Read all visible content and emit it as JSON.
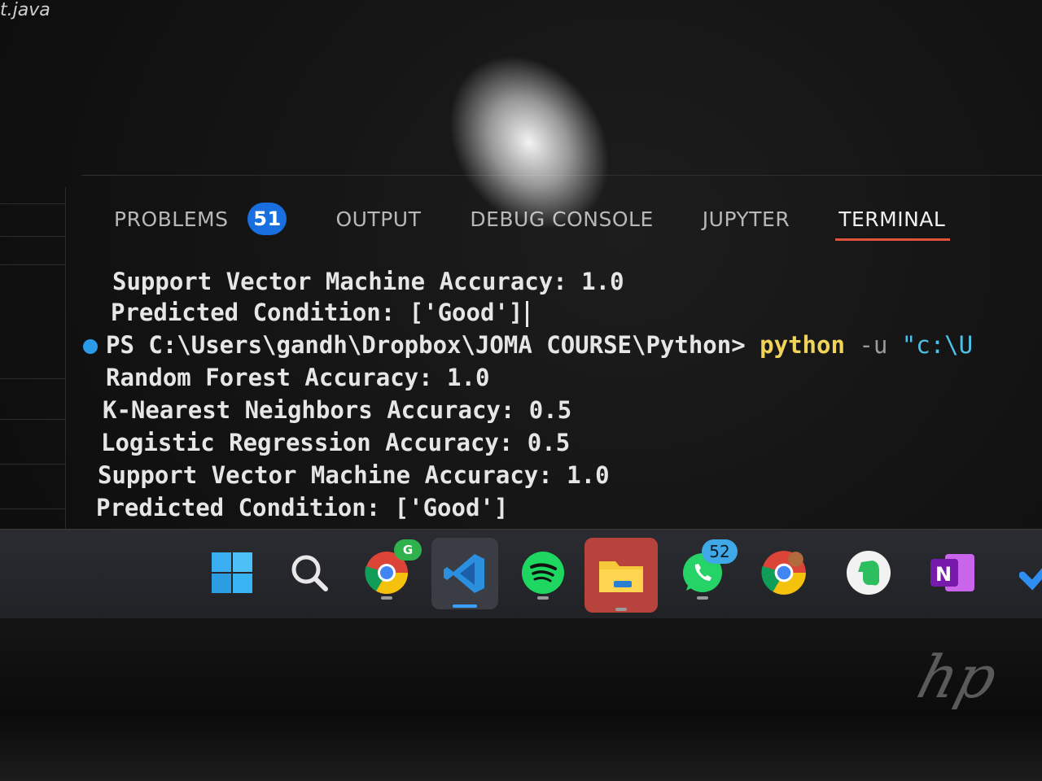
{
  "window": {
    "file_tab_fragment": "t.java"
  },
  "panel": {
    "tabs": [
      {
        "label": "PROBLEMS",
        "badge": "51"
      },
      {
        "label": "OUTPUT"
      },
      {
        "label": "DEBUG CONSOLE"
      },
      {
        "label": "JUPYTER"
      },
      {
        "label": "TERMINAL",
        "active": true
      }
    ],
    "terminal_lines": [
      "Support Vector Machine Accuracy: 1.0",
      "Predicted Condition: ['Good']",
      "Random Forest Accuracy: 1.0",
      "K-Nearest Neighbors Accuracy: 0.5",
      "Logistic Regression Accuracy: 0.5",
      "Support Vector Machine Accuracy: 1.0",
      "Predicted Condition: ['Good']"
    ],
    "prompt": {
      "path": "PS C:\\Users\\gandh\\Dropbox\\JOMA COURSE\\Python>",
      "command": "python",
      "flag": "-u",
      "arg": "\"c:\\U"
    }
  },
  "taskbar": {
    "icons": [
      {
        "name": "windows-start-icon"
      },
      {
        "name": "search-icon"
      },
      {
        "name": "chrome-profile-g-icon",
        "badge": "G"
      },
      {
        "name": "vscode-icon"
      },
      {
        "name": "spotify-icon"
      },
      {
        "name": "file-explorer-icon"
      },
      {
        "name": "whatsapp-icon",
        "badge": "52"
      },
      {
        "name": "chrome-profile-icon"
      },
      {
        "name": "evernote-icon"
      },
      {
        "name": "onenote-icon"
      }
    ]
  },
  "colors": {
    "badge_blue": "#1a6fe0",
    "active_tab_underline": "#e0523a",
    "command_yellow": "#f1d35a",
    "string_cyan": "#4fc1e9",
    "prompt_dot": "#2b9ae8"
  }
}
